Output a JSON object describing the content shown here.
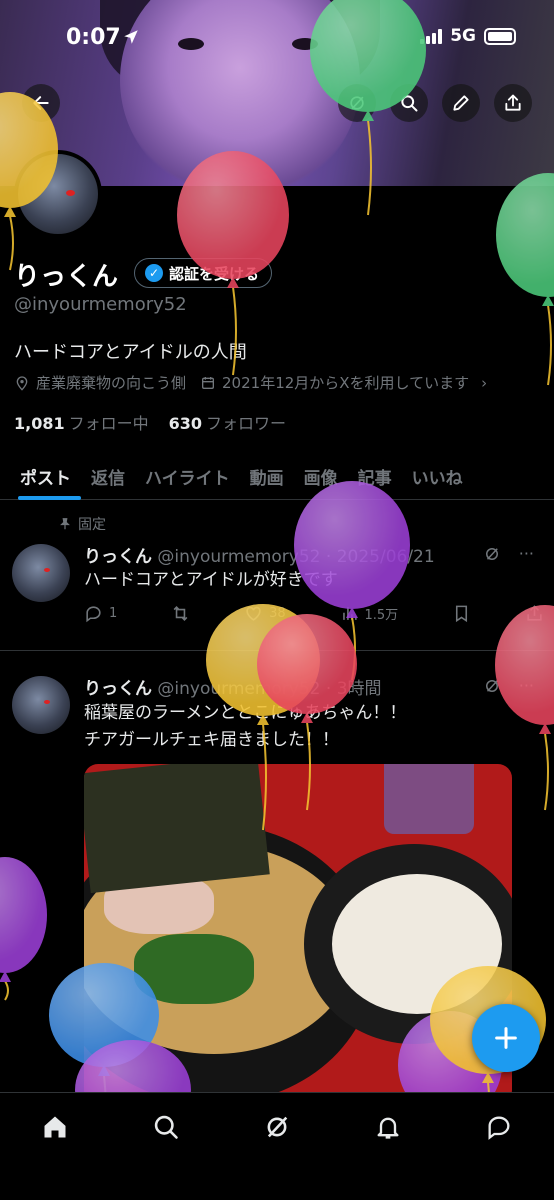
{
  "status_bar": {
    "time": "0:07",
    "network": "5G"
  },
  "profile": {
    "name": "りっくん",
    "verify_label": "認証を受ける",
    "handle": "@inyourmemory52",
    "bio": "ハードコアとアイドルの人間",
    "location": "産業廃棄物の向こう側",
    "joined": "2021年12月からXを利用しています",
    "following_count": "1,081",
    "following_label": "フォロー中",
    "followers_count": "630",
    "followers_label": "フォロワー"
  },
  "tabs": [
    {
      "label": "ポスト"
    },
    {
      "label": "返信"
    },
    {
      "label": "ハイライト"
    },
    {
      "label": "動画"
    },
    {
      "label": "画像"
    },
    {
      "label": "記事"
    },
    {
      "label": "いいね"
    }
  ],
  "pinned_label": "固定",
  "posts": [
    {
      "name": "りっくん",
      "meta": "@inyourmemory52 · 2025/06/21",
      "text": "ハードコアとアイドルが好きです",
      "replies": "1",
      "likes": "38",
      "views": "1.5万"
    },
    {
      "name": "りっくん",
      "meta": "@inyourmemory52 · 3時間",
      "text_line1": "稲葉屋のラーメンととこにゅあちゃん！！",
      "text_line2": "チアガールチェキ届きました！！"
    }
  ],
  "colors": {
    "accent": "#1d9bf0",
    "balloon_green": "#4cc97a",
    "balloon_red": "#e8455e",
    "balloon_yellow": "#f2c230",
    "balloon_purple": "#9b3fd6",
    "balloon_blue": "#3d8ee8"
  }
}
